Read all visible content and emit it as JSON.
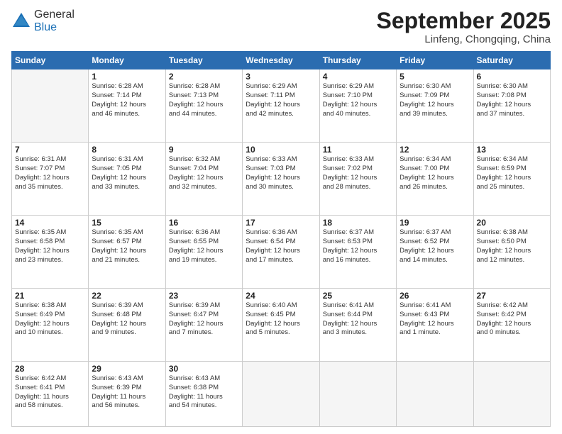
{
  "header": {
    "logo_line1": "General",
    "logo_line2": "Blue",
    "month_title": "September 2025",
    "location": "Linfeng, Chongqing, China"
  },
  "weekdays": [
    "Sunday",
    "Monday",
    "Tuesday",
    "Wednesday",
    "Thursday",
    "Friday",
    "Saturday"
  ],
  "weeks": [
    [
      {
        "day": "",
        "info": ""
      },
      {
        "day": "1",
        "info": "Sunrise: 6:28 AM\nSunset: 7:14 PM\nDaylight: 12 hours\nand 46 minutes."
      },
      {
        "day": "2",
        "info": "Sunrise: 6:28 AM\nSunset: 7:13 PM\nDaylight: 12 hours\nand 44 minutes."
      },
      {
        "day": "3",
        "info": "Sunrise: 6:29 AM\nSunset: 7:11 PM\nDaylight: 12 hours\nand 42 minutes."
      },
      {
        "day": "4",
        "info": "Sunrise: 6:29 AM\nSunset: 7:10 PM\nDaylight: 12 hours\nand 40 minutes."
      },
      {
        "day": "5",
        "info": "Sunrise: 6:30 AM\nSunset: 7:09 PM\nDaylight: 12 hours\nand 39 minutes."
      },
      {
        "day": "6",
        "info": "Sunrise: 6:30 AM\nSunset: 7:08 PM\nDaylight: 12 hours\nand 37 minutes."
      }
    ],
    [
      {
        "day": "7",
        "info": "Sunrise: 6:31 AM\nSunset: 7:07 PM\nDaylight: 12 hours\nand 35 minutes."
      },
      {
        "day": "8",
        "info": "Sunrise: 6:31 AM\nSunset: 7:05 PM\nDaylight: 12 hours\nand 33 minutes."
      },
      {
        "day": "9",
        "info": "Sunrise: 6:32 AM\nSunset: 7:04 PM\nDaylight: 12 hours\nand 32 minutes."
      },
      {
        "day": "10",
        "info": "Sunrise: 6:33 AM\nSunset: 7:03 PM\nDaylight: 12 hours\nand 30 minutes."
      },
      {
        "day": "11",
        "info": "Sunrise: 6:33 AM\nSunset: 7:02 PM\nDaylight: 12 hours\nand 28 minutes."
      },
      {
        "day": "12",
        "info": "Sunrise: 6:34 AM\nSunset: 7:00 PM\nDaylight: 12 hours\nand 26 minutes."
      },
      {
        "day": "13",
        "info": "Sunrise: 6:34 AM\nSunset: 6:59 PM\nDaylight: 12 hours\nand 25 minutes."
      }
    ],
    [
      {
        "day": "14",
        "info": "Sunrise: 6:35 AM\nSunset: 6:58 PM\nDaylight: 12 hours\nand 23 minutes."
      },
      {
        "day": "15",
        "info": "Sunrise: 6:35 AM\nSunset: 6:57 PM\nDaylight: 12 hours\nand 21 minutes."
      },
      {
        "day": "16",
        "info": "Sunrise: 6:36 AM\nSunset: 6:55 PM\nDaylight: 12 hours\nand 19 minutes."
      },
      {
        "day": "17",
        "info": "Sunrise: 6:36 AM\nSunset: 6:54 PM\nDaylight: 12 hours\nand 17 minutes."
      },
      {
        "day": "18",
        "info": "Sunrise: 6:37 AM\nSunset: 6:53 PM\nDaylight: 12 hours\nand 16 minutes."
      },
      {
        "day": "19",
        "info": "Sunrise: 6:37 AM\nSunset: 6:52 PM\nDaylight: 12 hours\nand 14 minutes."
      },
      {
        "day": "20",
        "info": "Sunrise: 6:38 AM\nSunset: 6:50 PM\nDaylight: 12 hours\nand 12 minutes."
      }
    ],
    [
      {
        "day": "21",
        "info": "Sunrise: 6:38 AM\nSunset: 6:49 PM\nDaylight: 12 hours\nand 10 minutes."
      },
      {
        "day": "22",
        "info": "Sunrise: 6:39 AM\nSunset: 6:48 PM\nDaylight: 12 hours\nand 9 minutes."
      },
      {
        "day": "23",
        "info": "Sunrise: 6:39 AM\nSunset: 6:47 PM\nDaylight: 12 hours\nand 7 minutes."
      },
      {
        "day": "24",
        "info": "Sunrise: 6:40 AM\nSunset: 6:45 PM\nDaylight: 12 hours\nand 5 minutes."
      },
      {
        "day": "25",
        "info": "Sunrise: 6:41 AM\nSunset: 6:44 PM\nDaylight: 12 hours\nand 3 minutes."
      },
      {
        "day": "26",
        "info": "Sunrise: 6:41 AM\nSunset: 6:43 PM\nDaylight: 12 hours\nand 1 minute."
      },
      {
        "day": "27",
        "info": "Sunrise: 6:42 AM\nSunset: 6:42 PM\nDaylight: 12 hours\nand 0 minutes."
      }
    ],
    [
      {
        "day": "28",
        "info": "Sunrise: 6:42 AM\nSunset: 6:41 PM\nDaylight: 11 hours\nand 58 minutes."
      },
      {
        "day": "29",
        "info": "Sunrise: 6:43 AM\nSunset: 6:39 PM\nDaylight: 11 hours\nand 56 minutes."
      },
      {
        "day": "30",
        "info": "Sunrise: 6:43 AM\nSunset: 6:38 PM\nDaylight: 11 hours\nand 54 minutes."
      },
      {
        "day": "",
        "info": ""
      },
      {
        "day": "",
        "info": ""
      },
      {
        "day": "",
        "info": ""
      },
      {
        "day": "",
        "info": ""
      }
    ]
  ]
}
